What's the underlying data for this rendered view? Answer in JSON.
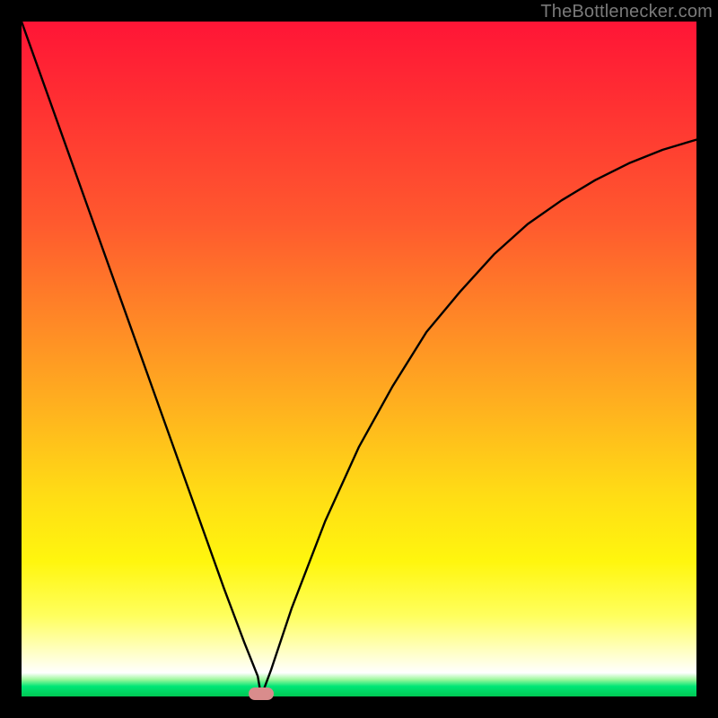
{
  "watermark": {
    "text": "TheBottleneсker.com"
  },
  "chart_data": {
    "type": "line",
    "title": "",
    "xlabel": "",
    "ylabel": "",
    "xlim": [
      0,
      1
    ],
    "ylim": [
      0,
      1
    ],
    "series": [
      {
        "name": "bottleneck-curve",
        "x": [
          0.0,
          0.05,
          0.1,
          0.15,
          0.2,
          0.25,
          0.3,
          0.33,
          0.35,
          0.355,
          0.37,
          0.4,
          0.45,
          0.5,
          0.55,
          0.6,
          0.65,
          0.7,
          0.75,
          0.8,
          0.85,
          0.9,
          0.95,
          1.0
        ],
        "values": [
          1.0,
          0.86,
          0.72,
          0.58,
          0.44,
          0.3,
          0.16,
          0.08,
          0.03,
          0.0,
          0.04,
          0.13,
          0.26,
          0.37,
          0.46,
          0.54,
          0.6,
          0.655,
          0.7,
          0.735,
          0.765,
          0.79,
          0.81,
          0.825
        ]
      }
    ],
    "annotations": [
      {
        "name": "min-marker",
        "x": 0.355,
        "y": 0.0,
        "color": "#d98c8c"
      }
    ],
    "background_gradient": {
      "stops": [
        {
          "pos": 0.0,
          "color": "#ff1536"
        },
        {
          "pos": 0.45,
          "color": "#ff8a26"
        },
        {
          "pos": 0.8,
          "color": "#fff60e"
        },
        {
          "pos": 0.965,
          "color": "#ffffff"
        },
        {
          "pos": 1.0,
          "color": "#00c853"
        }
      ]
    }
  }
}
